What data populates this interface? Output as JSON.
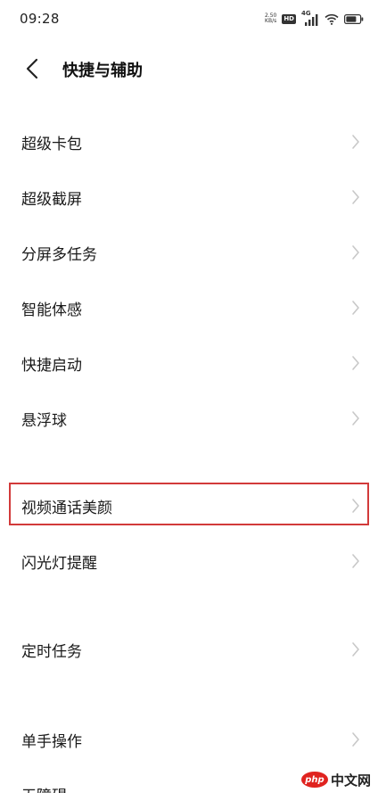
{
  "status_bar": {
    "time": "09:28",
    "net_speed_value": "2.50",
    "net_speed_unit": "KB/s",
    "hd_badge": "HD",
    "signal_label": "4G"
  },
  "header": {
    "title": "快捷与辅助"
  },
  "groups": [
    {
      "items": [
        {
          "label": "超级卡包"
        },
        {
          "label": "超级截屏"
        },
        {
          "label": "分屏多任务"
        },
        {
          "label": "智能体感"
        },
        {
          "label": "快捷启动"
        },
        {
          "label": "悬浮球"
        }
      ]
    },
    {
      "items": [
        {
          "label": "视频通话美颜",
          "highlighted": true
        },
        {
          "label": "闪光灯提醒"
        }
      ]
    },
    {
      "items": [
        {
          "label": "定时任务"
        }
      ]
    },
    {
      "items": [
        {
          "label": "单手操作"
        },
        {
          "label": "无障碍"
        }
      ]
    }
  ],
  "watermark": {
    "php": "php",
    "text": "中文网"
  },
  "colors": {
    "highlight_border": "#d23a3a",
    "chevron": "#c8c8c8"
  }
}
